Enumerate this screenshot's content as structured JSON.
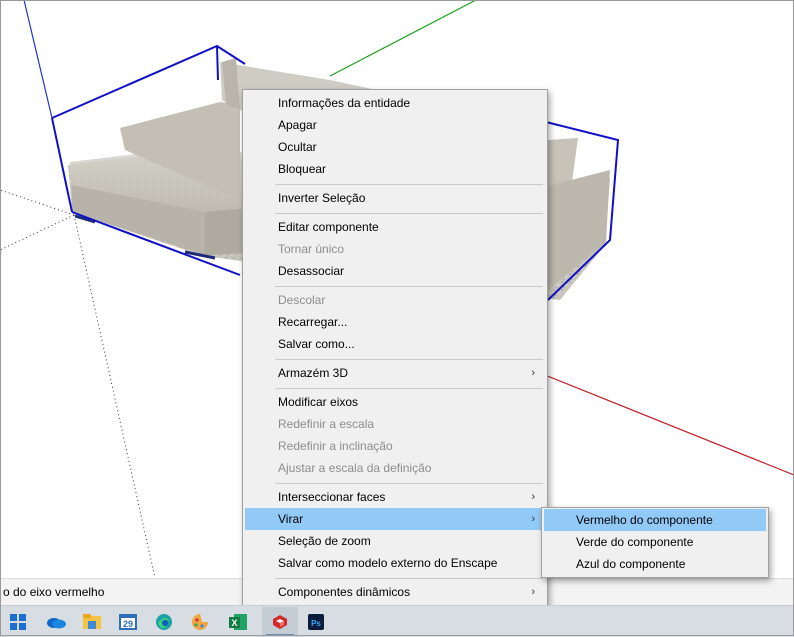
{
  "context_menu": {
    "items": [
      {
        "label": "Informações da entidade",
        "enabled": true
      },
      {
        "label": "Apagar",
        "enabled": true
      },
      {
        "label": "Ocultar",
        "enabled": true
      },
      {
        "label": "Bloquear",
        "enabled": true
      },
      {
        "label": "Inverter Seleção",
        "enabled": true
      },
      {
        "label": "Editar componente",
        "enabled": true
      },
      {
        "label": "Tornar único",
        "enabled": false
      },
      {
        "label": "Desassociar",
        "enabled": true
      },
      {
        "label": "Descolar",
        "enabled": false
      },
      {
        "label": "Recarregar...",
        "enabled": true
      },
      {
        "label": "Salvar como...",
        "enabled": true
      },
      {
        "label": "Armazém 3D",
        "enabled": true,
        "submenu": true
      },
      {
        "label": "Modificar eixos",
        "enabled": true
      },
      {
        "label": "Redefinir a escala",
        "enabled": false
      },
      {
        "label": "Redefinir a inclinação",
        "enabled": false
      },
      {
        "label": "Ajustar a escala da definição",
        "enabled": false
      },
      {
        "label": "Interseccionar faces",
        "enabled": true,
        "submenu": true
      },
      {
        "label": "Virar",
        "enabled": true,
        "submenu": true,
        "highlighted": true
      },
      {
        "label": "Seleção de zoom",
        "enabled": true
      },
      {
        "label": "Salvar como modelo externo do Enscape",
        "enabled": true
      },
      {
        "label": "Componentes dinâmicos",
        "enabled": true,
        "submenu": true
      }
    ],
    "submenu_arrow": "›"
  },
  "flip_submenu": {
    "items": [
      {
        "label": "Vermelho do componente",
        "highlighted": true
      },
      {
        "label": "Verde do componente"
      },
      {
        "label": "Azul do componente"
      }
    ]
  },
  "statusbar": {
    "text": "o do eixo vermelho"
  },
  "taskbar": {
    "calendar_day": "29",
    "excel_letter": "X",
    "photoshop_letters": "Ps",
    "apps": [
      "windows-start-icon",
      "onedrive-icon",
      "file-explorer-icon",
      "calendar-icon",
      "edge-icon",
      "paint-icon",
      "excel-icon",
      "sketchup-icon",
      "photoshop-icon"
    ],
    "active_app": "sketchup-icon"
  },
  "colors": {
    "red_axis": "#c0222b",
    "green_axis": "#1aa21a",
    "blue_axis": "#1f36c8",
    "selection_box": "#1010c8",
    "menu_bg": "#f0f0f0",
    "menu_highlight": "#91c9f7",
    "disabled_text": "#8d8d8d"
  }
}
